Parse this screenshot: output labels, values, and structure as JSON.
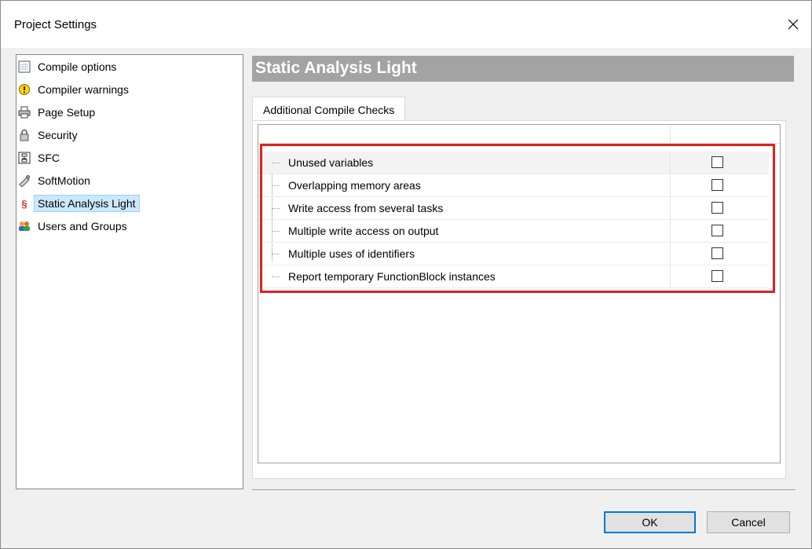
{
  "window": {
    "title": "Project Settings"
  },
  "tree": {
    "items": [
      {
        "label": "Compile options",
        "icon": "compile-options-icon"
      },
      {
        "label": "Compiler warnings",
        "icon": "warning-icon"
      },
      {
        "label": "Page Setup",
        "icon": "printer-icon"
      },
      {
        "label": "Security",
        "icon": "lock-icon"
      },
      {
        "label": "SFC",
        "icon": "sfc-icon"
      },
      {
        "label": "SoftMotion",
        "icon": "softmotion-icon"
      },
      {
        "label": "Static Analysis Light",
        "icon": "section-icon",
        "selected": true
      },
      {
        "label": "Users and Groups",
        "icon": "users-icon"
      }
    ]
  },
  "panel": {
    "header": "Static Analysis Light",
    "tab": "Additional Compile Checks",
    "checks": [
      {
        "label": "Unused variables",
        "checked": false
      },
      {
        "label": "Overlapping memory areas",
        "checked": false
      },
      {
        "label": "Write access from several tasks",
        "checked": false
      },
      {
        "label": "Multiple write access on output",
        "checked": false
      },
      {
        "label": "Multiple uses of identifiers",
        "checked": false
      },
      {
        "label": "Report temporary FunctionBlock instances",
        "checked": false
      }
    ]
  },
  "buttons": {
    "ok": "OK",
    "cancel": "Cancel"
  },
  "colors": {
    "highlight": "#e02020",
    "header_bg": "#a3a3a3",
    "selection": "#cce8ff"
  }
}
